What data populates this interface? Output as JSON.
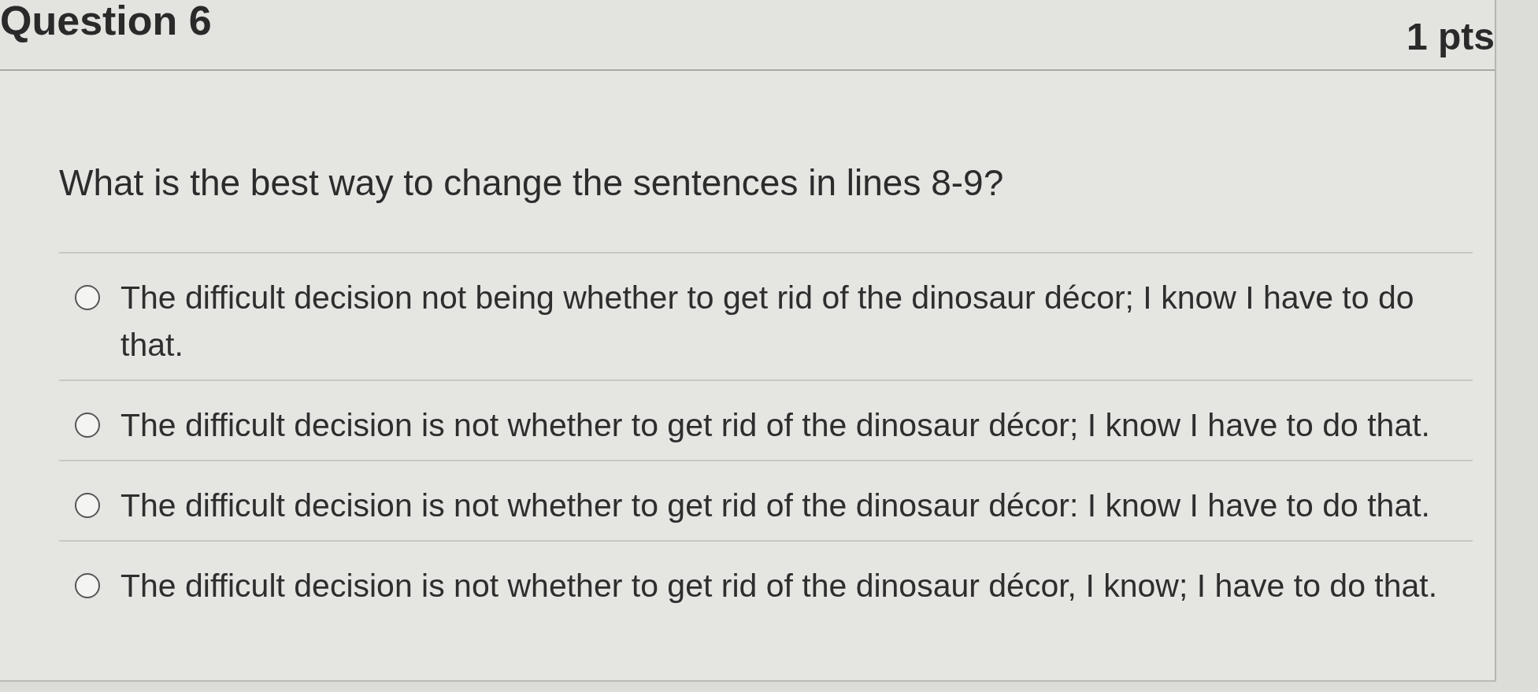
{
  "question": {
    "title": "Question 6",
    "points": "1 pts",
    "prompt": "What is the best way to change the sentences in lines 8-9?",
    "answers": [
      {
        "text": "The difficult decision not being whether to get rid of the dinosaur décor; I know I have to do that.",
        "selected": false
      },
      {
        "text": "The difficult decision is not whether to get rid of the dinosaur décor; I know I have to do that.",
        "selected": false
      },
      {
        "text": "The difficult decision is not whether to get rid of the dinosaur décor: I know I have to do that.",
        "selected": false
      },
      {
        "text": "The difficult decision is not whether to get rid of the dinosaur décor, I know; I have to do that.",
        "selected": false
      }
    ]
  }
}
